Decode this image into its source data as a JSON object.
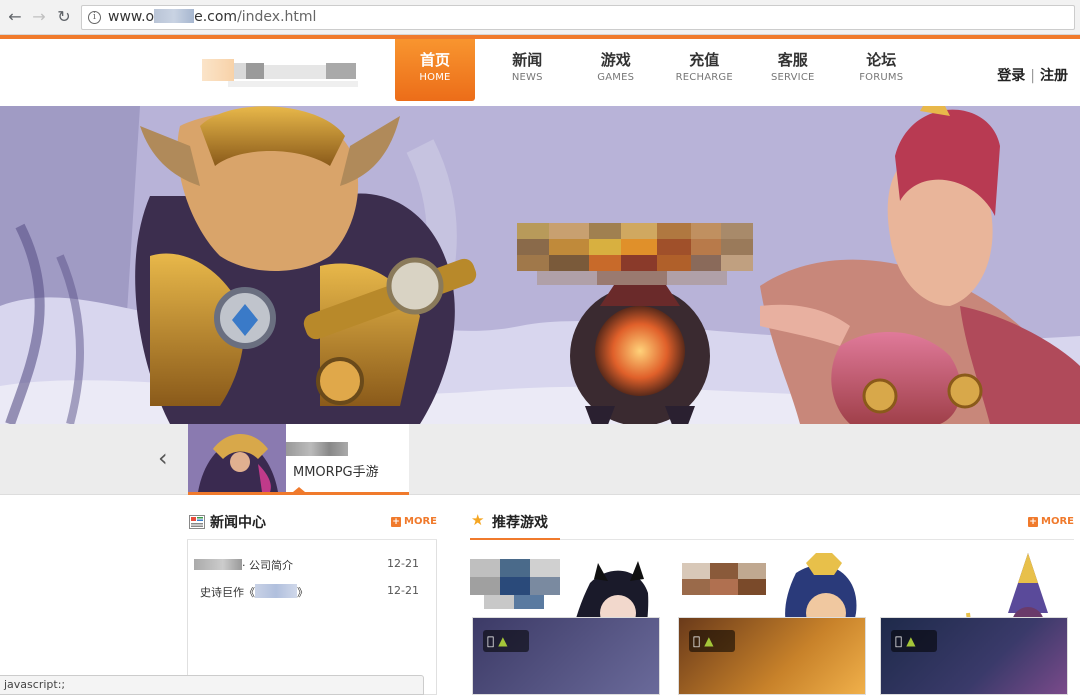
{
  "browser": {
    "url_prefix": "www.o",
    "url_suffix": "e.com",
    "url_path": "/index.html",
    "status_text": "javascript:;"
  },
  "nav": {
    "items": [
      {
        "cn": "首页",
        "en": "HOME",
        "active": true
      },
      {
        "cn": "新闻",
        "en": "NEWS"
      },
      {
        "cn": "游戏",
        "en": "GAMES"
      },
      {
        "cn": "充值",
        "en": "RECHARGE"
      },
      {
        "cn": "客服",
        "en": "SERVICE"
      },
      {
        "cn": "论坛",
        "en": "FORUMS"
      }
    ],
    "login": "登录",
    "register": "注册"
  },
  "game_strip": {
    "genre": "MMORPG手游"
  },
  "news": {
    "title": "新闻中心",
    "more": "MORE",
    "items": [
      {
        "text": "· 公司简介",
        "date": "12-21"
      },
      {
        "text_prefix": "史诗巨作《",
        "text_suffix": "》",
        "date": "12-21"
      }
    ]
  },
  "recommended": {
    "title": "推荐游戏",
    "more": "MORE"
  },
  "colors": {
    "accent": "#f07a2c",
    "android": "#a4c639"
  }
}
